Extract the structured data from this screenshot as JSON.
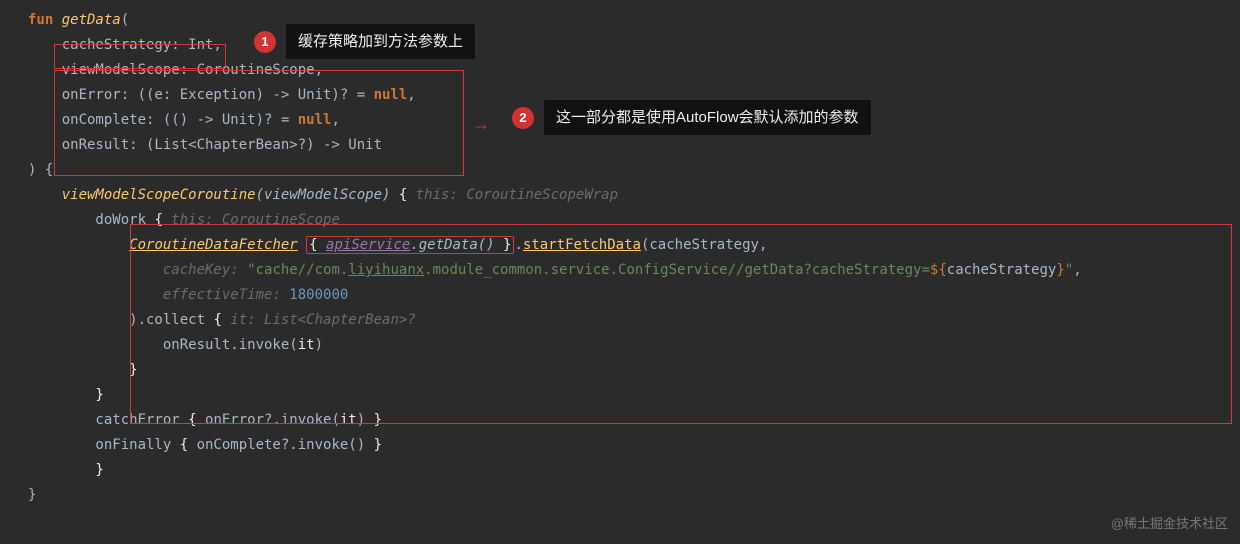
{
  "callouts": {
    "c1": {
      "num": "1",
      "text": "缓存策略加到方法参数上"
    },
    "c2": {
      "num": "2",
      "text": "这一部分都是使用AutoFlow会默认添加的参数"
    }
  },
  "code": {
    "l01a": "fun ",
    "l01b": "getData",
    "l01c": "(",
    "l02": "    cacheStrategy: Int,",
    "l03": "    viewModelScope: CoroutineScope,",
    "l04a": "    onError: ((e: Exception) -> Unit)? = ",
    "l04b": "null",
    "l04c": ",",
    "l05a": "    onComplete: (() -> Unit)? = ",
    "l05b": "null",
    "l05c": ",",
    "l06": "    onResult: (List<ChapterBean>?) -> Unit",
    "l07": ") {",
    "l08a": "    ",
    "l08b": "viewModelScopeCoroutine",
    "l08c": "(viewModelScope) ",
    "l08d": "{ ",
    "l08e": "this: CoroutineScopeWrap",
    "l09a": "        doWork ",
    "l09b": "{ ",
    "l09c": "this: CoroutineScope",
    "l10a": "            ",
    "l10b": "CoroutineDataFetcher",
    "l10c": " ",
    "l10d": "{ ",
    "l10e": "apiService",
    "l10f": ".getData() ",
    "l10g": "}",
    "l10h": ".",
    "l10i": "startFetchData",
    "l10j": "(cacheStrategy,",
    "l11a": "                ",
    "l11b": "cacheKey: ",
    "l11c": "\"cache//com.",
    "l11d": "liyihuanx",
    "l11e": ".module_common.service.ConfigService//getData?cacheStrategy=",
    "l11f": "${",
    "l11g": "cacheStrategy",
    "l11h": "}",
    "l11i": "\"",
    "l11j": ",",
    "l12a": "                ",
    "l12b": "effectiveTime: ",
    "l12c": "1800000",
    "l13a": "            ).collect ",
    "l13b": "{ ",
    "l13c": "it: List<ChapterBean>?",
    "l14a": "                onResult.invoke(",
    "l14b": "it",
    "l14c": ")",
    "l15": "            }",
    "l16": "        }",
    "l17a": "        catchError ",
    "l17b": "{ ",
    "l17c": "onError?.invoke(",
    "l17d": "it",
    "l17e": ") ",
    "l17f": "}",
    "l18a": "        onFinally ",
    "l18b": "{ ",
    "l18c": "onComplete?.invoke() ",
    "l18d": "}",
    "l19": "        }",
    "l20": "}"
  },
  "watermark": "@稀土掘金技术社区"
}
